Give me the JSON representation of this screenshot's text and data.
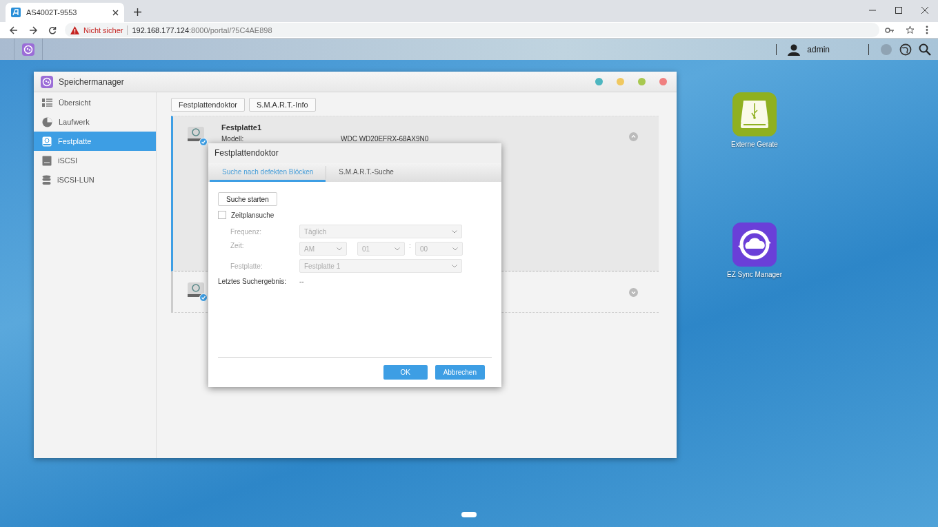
{
  "browser": {
    "tab": {
      "title": "AS4002T-9553"
    },
    "address": {
      "warning": "Nicht sicher",
      "host": "192.168.177.124",
      "path": ":8000/portal/?5C4AE898"
    }
  },
  "taskbar": {
    "user": "admin"
  },
  "window": {
    "title": "Speichermanager",
    "controls": [
      {
        "color": "#4db6c0"
      },
      {
        "color": "#f0c860"
      },
      {
        "color": "#a8c850"
      },
      {
        "color": "#f08080"
      }
    ],
    "sidebar": {
      "items": [
        {
          "label": "Übersicht",
          "kind": "list",
          "selected": false
        },
        {
          "label": "Laufwerk",
          "kind": "pie",
          "selected": false
        },
        {
          "label": "Festplatte",
          "kind": "disk",
          "selected": true
        },
        {
          "label": "iSCSI",
          "kind": "server",
          "selected": false
        },
        {
          "label": "iSCSI-LUN",
          "kind": "stack",
          "selected": false
        }
      ]
    },
    "toolbar": [
      "Festplattendoktor",
      "S.M.A.R.T.-Info"
    ],
    "disks": [
      {
        "name": "Festplatte1",
        "selected": true,
        "expanded": true,
        "fields": [
          {
            "label": "Modell:",
            "value": "WDC WD20EFRX-68AX9N0"
          }
        ]
      },
      {
        "selected": false,
        "expanded": false
      }
    ]
  },
  "dialog": {
    "title": "Festplattendoktor",
    "tabs": [
      {
        "label": "Suche nach defekten Blöcken",
        "selected": true
      },
      {
        "label": "S.M.A.R.T.-Suche",
        "selected": false
      }
    ],
    "start_button": "Suche starten",
    "schedule": {
      "label": "Zeitplansuche",
      "checked": false
    },
    "frequency": {
      "label": "Frequenz:",
      "value": "Täglich",
      "disabled": true
    },
    "time": {
      "label": "Zeit:",
      "period": "AM",
      "hour": "01",
      "separator": ":",
      "minute": "00",
      "disabled": true
    },
    "disk": {
      "label": "Festplatte:",
      "value": "Festplatte 1",
      "disabled": true
    },
    "last_result": {
      "label": "Letztes Suchergebnis:",
      "value": "--"
    },
    "buttons": [
      "OK",
      "Abbrechen"
    ]
  },
  "desktop_icons": [
    {
      "label": "Externe Gerate",
      "kind": "usb"
    },
    {
      "label": "EZ Sync Manager",
      "kind": "sync"
    }
  ]
}
